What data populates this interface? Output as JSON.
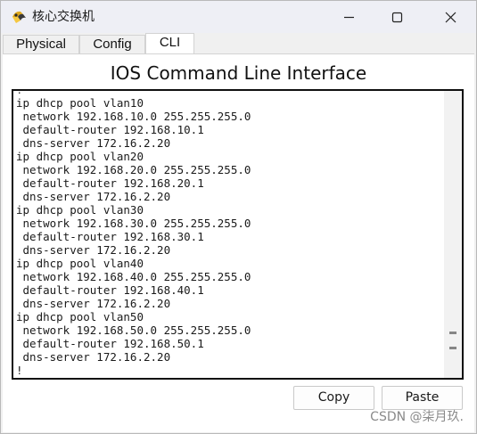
{
  "window": {
    "title": "核心交换机",
    "app_icon": "packet-tracer-icon",
    "controls": {
      "minimize": "minimize-icon",
      "maximize": "maximize-icon",
      "close": "close-icon"
    }
  },
  "tabs": [
    {
      "label": "Physical",
      "active": false
    },
    {
      "label": "Config",
      "active": false
    },
    {
      "label": "CLI",
      "active": true
    }
  ],
  "panel": {
    "title": "IOS Command Line Interface"
  },
  "terminal": {
    "lines": [
      "!",
      "ip dhcp pool vlan10",
      " network 192.168.10.0 255.255.255.0",
      " default-router 192.168.10.1",
      " dns-server 172.16.2.20",
      "ip dhcp pool vlan20",
      " network 192.168.20.0 255.255.255.0",
      " default-router 192.168.20.1",
      " dns-server 172.16.2.20",
      "ip dhcp pool vlan30",
      " network 192.168.30.0 255.255.255.0",
      " default-router 192.168.30.1",
      " dns-server 172.16.2.20",
      "ip dhcp pool vlan40",
      " network 192.168.40.0 255.255.255.0",
      " default-router 192.168.40.1",
      " dns-server 172.16.2.20",
      "ip dhcp pool vlan50",
      " network 192.168.50.0 255.255.255.0",
      " default-router 192.168.50.1",
      " dns-server 172.16.2.20",
      "!"
    ]
  },
  "buttons": {
    "copy": "Copy",
    "paste": "Paste"
  },
  "watermark": "CSDN @柒月玖."
}
